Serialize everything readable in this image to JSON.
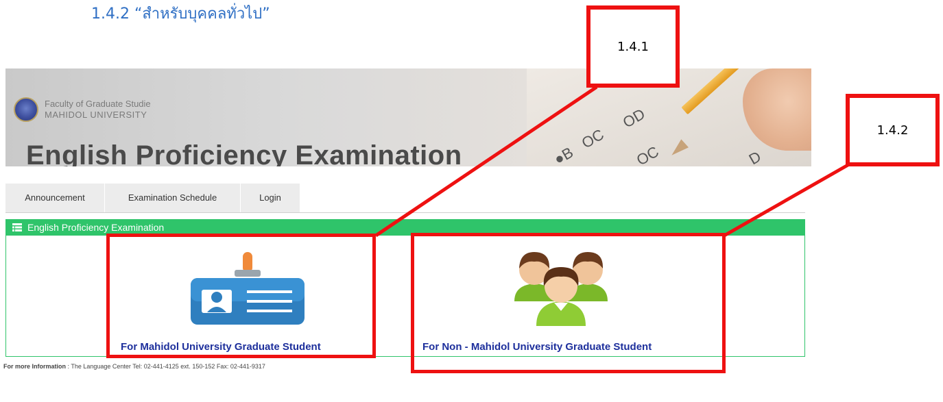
{
  "heading": "1.4.2 “สำหรับบุคคลทั่วไป”",
  "banner": {
    "faculty": "Faculty of Graduate Studie",
    "university": "MAHIDOL UNIVERSITY",
    "title": "English Proficiency Examination",
    "sheet_marks": [
      "●B",
      "OC",
      "OD",
      "OC",
      "D"
    ]
  },
  "nav": {
    "tabs": [
      "Announcement",
      "Examination Schedule",
      "Login"
    ]
  },
  "panel": {
    "header": "English Proficiency Examination",
    "options": [
      {
        "label": "For Mahidol University Graduate Student",
        "icon": "id-card-icon"
      },
      {
        "label": "For Non - Mahidol University Graduate Student",
        "icon": "user-group-icon"
      }
    ]
  },
  "footer": {
    "label": "For more Information",
    "text": " : The Language Center Tel: 02-441-4125 ext. 150-152 Fax: 02-441-9317"
  },
  "callouts": [
    "1.4.1",
    "1.4.2"
  ],
  "colors": {
    "accent_green": "#2fc46a",
    "link_blue": "#1d2f9c",
    "annotation_red": "#ee1111",
    "heading_blue": "#2f6fc4"
  }
}
